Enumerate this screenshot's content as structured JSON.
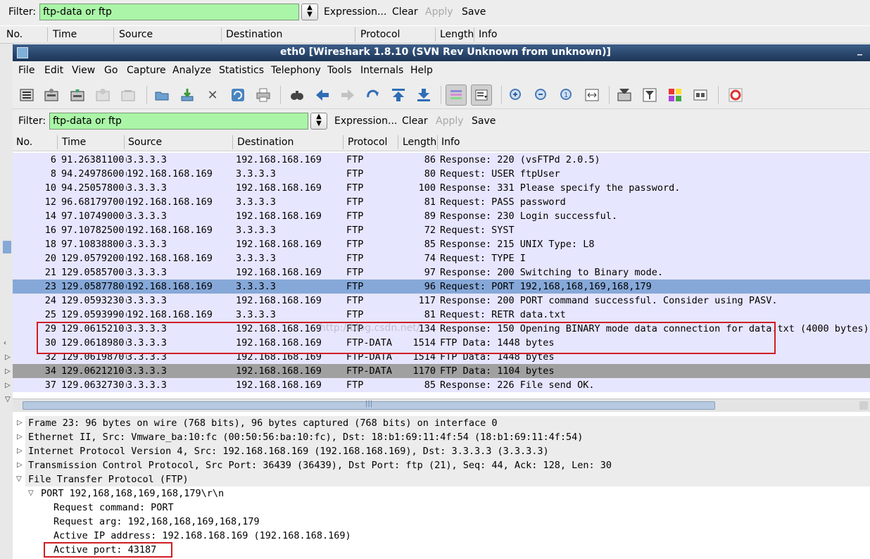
{
  "bg_window": {
    "filter_label": "Filter:",
    "filter_value": "ftp-data or ftp",
    "expression_label": "Expression...",
    "clear_label": "Clear",
    "apply_label": "Apply",
    "save_label": "Save",
    "columns": [
      "No.",
      "Time",
      "Source",
      "Destination",
      "Protocol",
      "Length",
      "Info"
    ]
  },
  "window": {
    "title": "eth0   [Wireshark 1.8.10  (SVN Rev Unknown from unknown)]",
    "minimize_glyph": "_"
  },
  "menu": [
    "File",
    "Edit",
    "View",
    "Go",
    "Capture",
    "Analyze",
    "Statistics",
    "Telephony",
    "Tools",
    "Internals",
    "Help"
  ],
  "toolbar_icons": [
    "interface-list-icon",
    "capture-options-icon",
    "start-capture-icon",
    "stop-capture-icon",
    "restart-capture-icon",
    "open-file-icon",
    "save-file-icon",
    "close-file-icon",
    "reload-icon",
    "print-icon",
    "find-packet-icon",
    "go-back-icon",
    "go-forward-icon",
    "go-to-packet-icon",
    "go-first-icon",
    "go-last-icon",
    "colorize-icon",
    "auto-scroll-icon",
    "zoom-in-icon",
    "zoom-out-icon",
    "normal-size-icon",
    "resize-columns-icon",
    "capture-filters-icon",
    "display-filters-icon",
    "coloring-rules-icon",
    "preferences-icon",
    "help-icon"
  ],
  "filter": {
    "label": "Filter:",
    "value": "ftp-data or ftp",
    "expression_label": "Expression...",
    "clear_label": "Clear",
    "apply_label": "Apply",
    "save_label": "Save"
  },
  "packet_list": {
    "columns": [
      "No.",
      "Time",
      "Source",
      "Destination",
      "Protocol",
      "Length",
      "Info"
    ],
    "rows": [
      {
        "no": "6",
        "time": "91.26381100(",
        "src": "3.3.3.3",
        "dst": "192.168.168.169",
        "proto": "FTP",
        "len": "86",
        "info": "Response: 220 (vsFTPd 2.0.5)"
      },
      {
        "no": "8",
        "time": "94.24978600(",
        "src": "192.168.168.169",
        "dst": "3.3.3.3",
        "proto": "FTP",
        "len": "80",
        "info": "Request: USER ftpUser"
      },
      {
        "no": "10",
        "time": "94.25057800(",
        "src": "3.3.3.3",
        "dst": "192.168.168.169",
        "proto": "FTP",
        "len": "100",
        "info": "Response: 331 Please specify the password."
      },
      {
        "no": "12",
        "time": "96.68179700(",
        "src": "192.168.168.169",
        "dst": "3.3.3.3",
        "proto": "FTP",
        "len": "81",
        "info": "Request: PASS password"
      },
      {
        "no": "14",
        "time": "97.10749000(",
        "src": "3.3.3.3",
        "dst": "192.168.168.169",
        "proto": "FTP",
        "len": "89",
        "info": "Response: 230 Login successful."
      },
      {
        "no": "16",
        "time": "97.10782500(",
        "src": "192.168.168.169",
        "dst": "3.3.3.3",
        "proto": "FTP",
        "len": "72",
        "info": "Request: SYST"
      },
      {
        "no": "18",
        "time": "97.10838800(",
        "src": "3.3.3.3",
        "dst": "192.168.168.169",
        "proto": "FTP",
        "len": "85",
        "info": "Response: 215 UNIX Type: L8"
      },
      {
        "no": "20",
        "time": "129.0579200(",
        "src": "192.168.168.169",
        "dst": "3.3.3.3",
        "proto": "FTP",
        "len": "74",
        "info": "Request: TYPE I"
      },
      {
        "no": "21",
        "time": "129.0585700(",
        "src": "3.3.3.3",
        "dst": "192.168.168.169",
        "proto": "FTP",
        "len": "97",
        "info": "Response: 200 Switching to Binary mode."
      },
      {
        "no": "23",
        "time": "129.0587780(",
        "src": "192.168.168.169",
        "dst": "3.3.3.3",
        "proto": "FTP",
        "len": "96",
        "info": "Request: PORT 192,168,168,169,168,179"
      },
      {
        "no": "24",
        "time": "129.0593230(",
        "src": "3.3.3.3",
        "dst": "192.168.168.169",
        "proto": "FTP",
        "len": "117",
        "info": "Response: 200 PORT command successful. Consider using PASV."
      },
      {
        "no": "25",
        "time": "129.0593990(",
        "src": "192.168.168.169",
        "dst": "3.3.3.3",
        "proto": "FTP",
        "len": "81",
        "info": "Request: RETR data.txt"
      },
      {
        "no": "29",
        "time": "129.0615210(",
        "src": "3.3.3.3",
        "dst": "192.168.168.169",
        "proto": "FTP",
        "len": "134",
        "info": "Response: 150 Opening BINARY mode data connection for data.txt (4000 bytes)."
      },
      {
        "no": "30",
        "time": "129.0618980(",
        "src": "3.3.3.3",
        "dst": "192.168.168.169",
        "proto": "FTP-DATA",
        "len": "1514",
        "info": "FTP Data: 1448 bytes"
      },
      {
        "no": "32",
        "time": "129.0619870(",
        "src": "3.3.3.3",
        "dst": "192.168.168.169",
        "proto": "FTP-DATA",
        "len": "1514",
        "info": "FTP Data: 1448 bytes"
      },
      {
        "no": "34",
        "time": "129.0621210(",
        "src": "3.3.3.3",
        "dst": "192.168.168.169",
        "proto": "FTP-DATA",
        "len": "1170",
        "info": "FTP Data: 1104 bytes"
      },
      {
        "no": "37",
        "time": "129.0632730(",
        "src": "3.3.3.3",
        "dst": "192.168.168.169",
        "proto": "FTP",
        "len": "85",
        "info": "Response: 226 File send OK."
      }
    ],
    "selected_no": "23",
    "watermark": "http://blog.csdn.net/"
  },
  "details": {
    "tree": [
      {
        "text": "Frame 23: 96 bytes on wire (768 bits), 96 bytes captured (768 bits) on interface 0",
        "state": "collapsed"
      },
      {
        "text": "Ethernet II, Src: Vmware_ba:10:fc (00:50:56:ba:10:fc), Dst: 18:b1:69:11:4f:54 (18:b1:69:11:4f:54)",
        "state": "collapsed"
      },
      {
        "text": "Internet Protocol Version 4, Src: 192.168.168.169 (192.168.168.169), Dst: 3.3.3.3 (3.3.3.3)",
        "state": "collapsed"
      },
      {
        "text": "Transmission Control Protocol, Src Port: 36439 (36439), Dst Port: ftp (21), Seq: 44, Ack: 128, Len: 30",
        "state": "collapsed"
      },
      {
        "text": "File Transfer Protocol (FTP)",
        "state": "expanded"
      }
    ],
    "port_node": "PORT 192,168,168,169,168,179\\r\\n",
    "fields": [
      "Request command: PORT",
      "Request arg: 192,168,168,169,168,179",
      "Active IP address: 192.168.168.169 (192.168.168.169)",
      "Active port: 43187"
    ]
  },
  "colors": {
    "filter_green": "#aaf5a7",
    "row_ftp": "#e7e6ff",
    "row_selected": "#86a8d8",
    "row_dark": "#a0a0a0",
    "highlight_red": "#d01d22",
    "titlebar": "#1c3556"
  }
}
